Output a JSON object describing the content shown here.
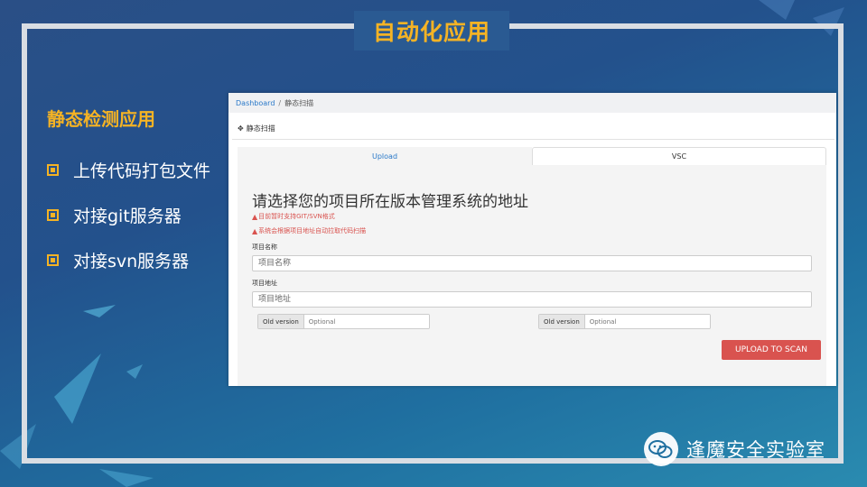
{
  "slide": {
    "title": "自动化应用",
    "section_title": "静态检测应用",
    "bullets": [
      {
        "text": "上传代码打包文件"
      },
      {
        "text": "对接git服务器"
      },
      {
        "text": "对接svn服务器"
      }
    ]
  },
  "app": {
    "breadcrumb": {
      "root": "Dashboard",
      "separator": "/",
      "current": "静态扫描"
    },
    "card_title": "静态扫描",
    "tabs": [
      {
        "label": "Upload",
        "active": true
      },
      {
        "label": "VSC",
        "active": false
      }
    ],
    "heading": "请选择您的项目所在版本管理系统的地址",
    "warnings": [
      "目前暂时支持GIT/SVN格式",
      "系统会根据项目地址自动拉取代码扫描"
    ],
    "project_name": {
      "label": "项目名称",
      "placeholder": "项目名称",
      "value": ""
    },
    "project_url": {
      "label": "项目地址",
      "placeholder": "项目地址",
      "value": ""
    },
    "old_version_left": {
      "addon": "Old version",
      "placeholder": "Optional"
    },
    "old_version_right": {
      "addon": "Old version",
      "placeholder": "Optional"
    },
    "upload_button": "UPLOAD TO SCAN"
  },
  "watermark": {
    "text": "逢魔安全实验室",
    "icon": "wechat-icon"
  },
  "colors": {
    "accent": "#f5b324",
    "danger": "#d9534f",
    "link": "#2a79c9"
  }
}
